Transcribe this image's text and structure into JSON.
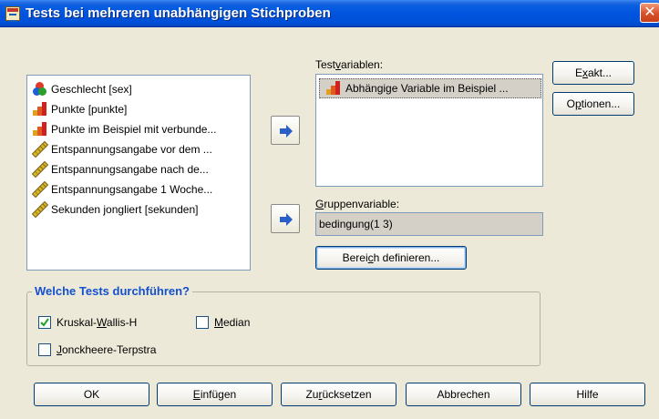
{
  "window": {
    "title": "Tests bei mehreren unabhängigen Stichproben",
    "close_glyph": "✕"
  },
  "source_list": {
    "items": [
      {
        "label": "Geschlecht [sex]",
        "icon": "nominal-icon"
      },
      {
        "label": "Punkte [punkte]",
        "icon": "ordinal-icon"
      },
      {
        "label": "Punkte im Beispiel mit verbunde...",
        "icon": "ordinal-icon"
      },
      {
        "label": "Entspannungsangabe vor dem ...",
        "icon": "scale-icon"
      },
      {
        "label": "Entspannungsangabe nach de...",
        "icon": "scale-icon"
      },
      {
        "label": "Entspannungsangabe 1 Woche...",
        "icon": "scale-icon"
      },
      {
        "label": "Sekunden jongliert [sekunden]",
        "icon": "scale-icon"
      }
    ]
  },
  "test_variables": {
    "label_pre": "Test",
    "label_u": "v",
    "label_post": "ariablen:",
    "items": [
      {
        "label": "Abhängige Variable im Beispiel ...",
        "icon": "ordinal-icon"
      }
    ]
  },
  "group_variable": {
    "label_u": "G",
    "label_post": "ruppenvariable:",
    "value": "bedingung(1 3)",
    "define_pre": "Berei",
    "define_u": "c",
    "define_post": "h definieren..."
  },
  "side_buttons": {
    "exact_pre": "E",
    "exact_u": "x",
    "exact_post": "akt...",
    "options_pre": "O",
    "options_u": "p",
    "options_post": "tionen..."
  },
  "tests_group": {
    "title": "Welche Tests durchführen?",
    "kruskal": {
      "pre": "Kruskal-",
      "u": "W",
      "post": "allis-H",
      "checked": true
    },
    "median": {
      "u": "M",
      "post": "edian",
      "checked": false
    },
    "jonckheere": {
      "u": "J",
      "post": "onckheere-Terpstra",
      "checked": false
    }
  },
  "bottom_buttons": {
    "ok": "OK",
    "paste_u": "E",
    "paste_post": "infügen",
    "reset_pre": "Zu",
    "reset_u": "r",
    "reset_post": "ücksetzen",
    "cancel": "Abbrechen",
    "help": "Hilfe"
  },
  "colors": {
    "title_bar": "#0053dd",
    "group_title": "#1450d0",
    "dialog_bg": "#ece9d8",
    "arrow": "#2a5fc8"
  }
}
